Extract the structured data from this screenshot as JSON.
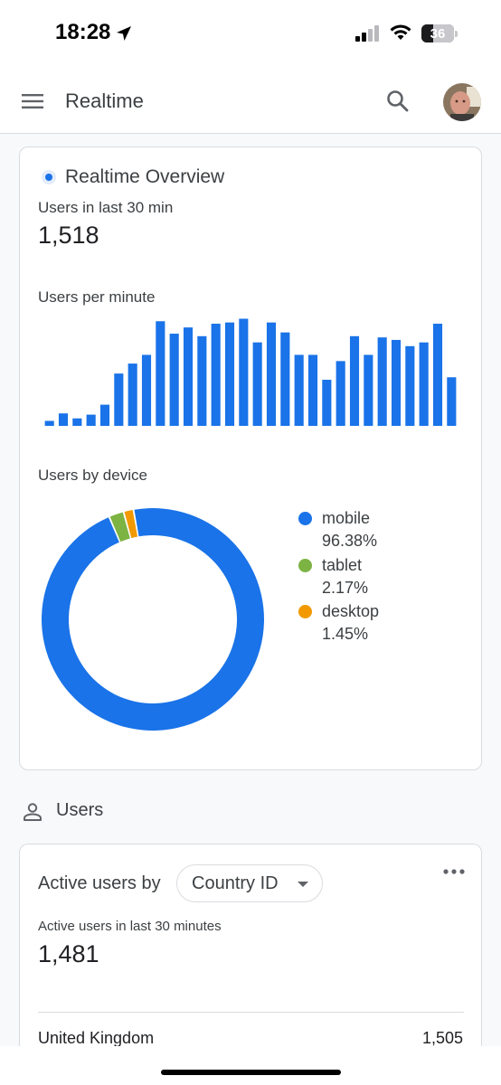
{
  "status_bar": {
    "time": "18:28",
    "battery": "36",
    "battery_level": 0.36
  },
  "app_bar": {
    "title": "Realtime",
    "menu_icon": "menu-icon",
    "search_icon": "search-icon"
  },
  "overview": {
    "title": "Realtime Overview",
    "users_label": "Users in last 30 min",
    "users_value": "1,518",
    "per_minute_label": "Users per minute",
    "device_label": "Users by device"
  },
  "chart_data": [
    {
      "type": "bar",
      "title": "Users per minute",
      "values": [
        4,
        10,
        6,
        9,
        17,
        42,
        50,
        57,
        84,
        74,
        79,
        72,
        82,
        83,
        86,
        67,
        83,
        75,
        57,
        57,
        37,
        52,
        72,
        57,
        71,
        69,
        64,
        67,
        82,
        39
      ],
      "ylim": [
        0,
        90
      ],
      "color": "#1a73e8"
    },
    {
      "type": "pie",
      "title": "Users by device",
      "categories": [
        "mobile",
        "tablet",
        "desktop"
      ],
      "values": [
        96.38,
        2.17,
        1.45
      ],
      "colors": [
        "#1a73e8",
        "#7cb342",
        "#f29900"
      ],
      "legend": "right"
    }
  ],
  "legend": [
    {
      "label": "mobile",
      "pct": "96.38%",
      "color": "#1a73e8"
    },
    {
      "label": "tablet",
      "pct": "2.17%",
      "color": "#7cb342"
    },
    {
      "label": "desktop",
      "pct": "1.45%",
      "color": "#f29900"
    }
  ],
  "users_section": {
    "title": "Users",
    "icon": "person-icon"
  },
  "active_card": {
    "prefix": "Active users by",
    "dimension": "Country ID",
    "subtitle": "Active users in last 30 minutes",
    "value": "1,481",
    "rows": [
      {
        "country": "United Kingdom",
        "value": "1,505"
      }
    ]
  }
}
